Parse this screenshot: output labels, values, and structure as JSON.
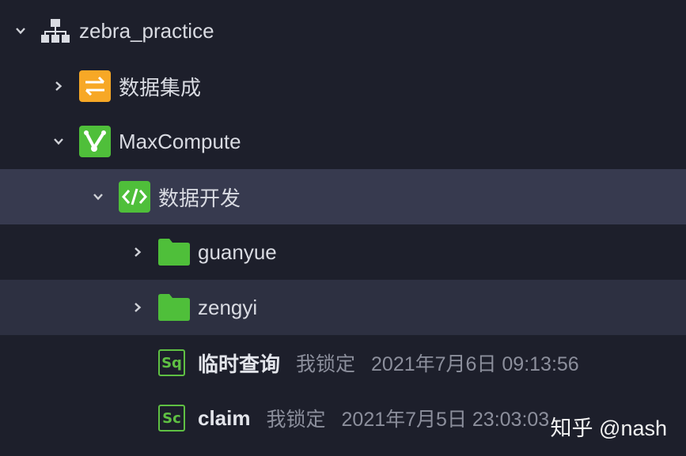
{
  "tree": {
    "root": {
      "label": "zebra_practice",
      "icon": "hierarchy-icon",
      "expanded": true
    },
    "data_integration": {
      "label": "数据集成",
      "icon": "transfer-arrows-icon",
      "expanded": false,
      "icon_color": "#f7a826"
    },
    "maxcompute": {
      "label": "MaxCompute",
      "icon": "maxcompute-logo-icon",
      "expanded": true,
      "icon_color": "#4fbf3a"
    },
    "data_dev": {
      "label": "数据开发",
      "icon": "code-brackets-icon",
      "expanded": true,
      "selected": true,
      "icon_color": "#4fbf3a"
    },
    "folders": [
      {
        "label": "guanyue",
        "icon": "folder-icon",
        "expanded": false
      },
      {
        "label": "zengyi",
        "icon": "folder-icon",
        "expanded": false
      }
    ],
    "files": [
      {
        "badge": "Sq",
        "label": "临时查询",
        "lock": "我锁定",
        "time": "2021年7月6日 09:13:56",
        "icon": "sql-file-icon"
      },
      {
        "badge": "Sc",
        "label": "claim",
        "lock": "我锁定",
        "time": "2021年7月5日 23:03:03",
        "icon": "script-file-icon"
      }
    ]
  },
  "watermark": "知乎 @nash",
  "colors": {
    "background": "#1d1f2b",
    "selected_row": "#373a4f",
    "hover_row": "#2d3041",
    "accent_green": "#4fbf3a",
    "accent_orange": "#f7a826"
  }
}
